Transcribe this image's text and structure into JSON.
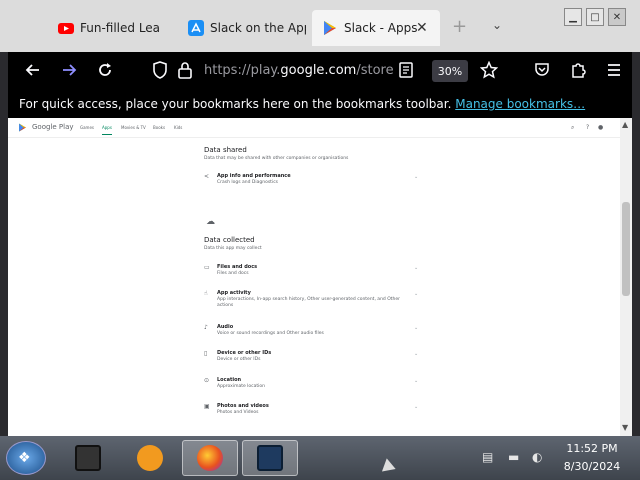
{
  "tabs": [
    {
      "title": "Fun-filled Lea",
      "icon": "youtube-icon",
      "color": "#ff0000"
    },
    {
      "title": "Slack on the App",
      "icon": "app-store-icon",
      "color": "#1b8ff5"
    },
    {
      "title": "Slack - Apps",
      "icon": "google-play-icon",
      "close": "✕"
    }
  ],
  "tabstrip": {
    "new_tab": "+",
    "list_tabs": "⌄"
  },
  "window_controls": {
    "minimize": "▁",
    "maximize": "□",
    "close": "✕"
  },
  "navbar": {
    "url_prefix": "https://play.",
    "url_domain": "google.com",
    "url_suffix": "/store",
    "zoom": "30%"
  },
  "bookmarks_bar": {
    "message": "For quick access, place your bookmarks here on the bookmarks toolbar.",
    "link": "Manage bookmarks…"
  },
  "google_play": {
    "brand": "Google Play",
    "nav": [
      "Games",
      "Apps",
      "Movies & TV",
      "Books",
      "Kids"
    ]
  },
  "data_shared": {
    "title": "Data shared",
    "subtitle": "Data that may be shared with other companies or organisations",
    "items": [
      {
        "title": "App info and performance",
        "desc": "Crash logs and Diagnostics"
      }
    ]
  },
  "data_collected": {
    "title": "Data collected",
    "subtitle": "Data this app may collect",
    "items": [
      {
        "title": "Files and docs",
        "desc": "Files and docs"
      },
      {
        "title": "App activity",
        "desc": "App interactions, In-app search history, Other user-generated content, and Other actions"
      },
      {
        "title": "Audio",
        "desc": "Voice or sound recordings and Other audio files"
      },
      {
        "title": "Device or other IDs",
        "desc": "Device or other IDs"
      },
      {
        "title": "Location",
        "desc": "Approximate location"
      },
      {
        "title": "Photos and videos",
        "desc": "Photos and Videos"
      }
    ]
  },
  "taskbar": {
    "start": "❖",
    "clock_time": "11:52 PM",
    "clock_date": "8/30/2024"
  }
}
